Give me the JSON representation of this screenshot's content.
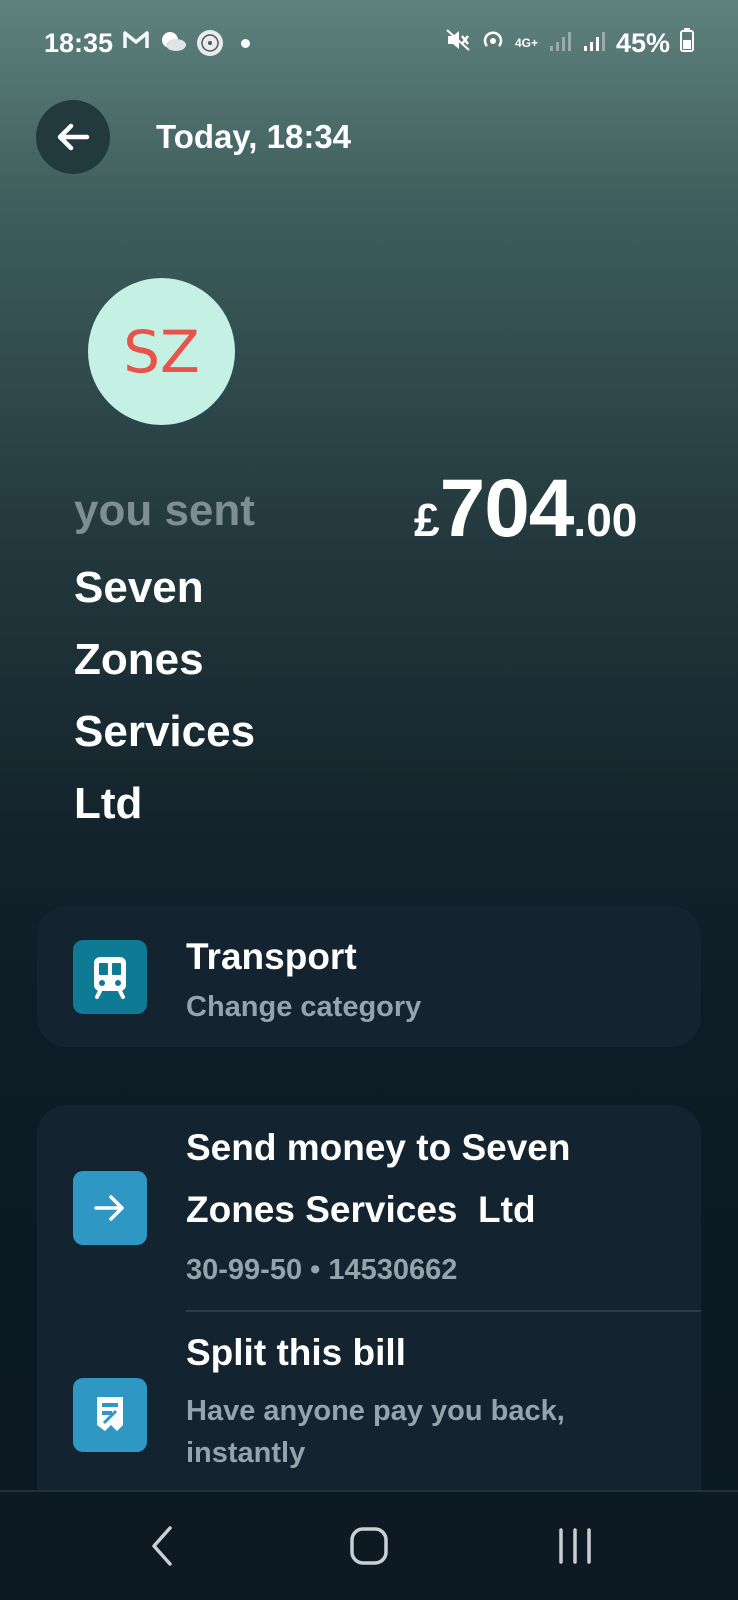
{
  "status_bar": {
    "time": "18:35",
    "battery": "45%",
    "network": "4G+",
    "icons": [
      "gmail-icon",
      "weather-icon",
      "word-game-icon",
      "notification-dot",
      "mute-icon",
      "hotspot-icon",
      "network-4g-icon",
      "signal-icon",
      "signal-icon",
      "battery-icon"
    ]
  },
  "header": {
    "title": "Today, 18:34"
  },
  "avatar": {
    "initials": "SZ",
    "background": "#c4f1e3",
    "text_color": "#e8534a"
  },
  "transaction": {
    "direction_label": "you sent",
    "recipient_lines": [
      "Seven",
      "Zones",
      "Services",
      "Ltd"
    ],
    "amount": {
      "currency": "£",
      "whole": "704",
      "decimal": ".00"
    }
  },
  "category": {
    "name": "Transport",
    "action": "Change category",
    "icon": "bus-icon",
    "icon_color": "#0f7a93"
  },
  "actions": [
    {
      "title_lines": [
        "Send money to Seven",
        "Zones Services  Ltd"
      ],
      "subtitle": "30-99-50 • 14530662",
      "icon": "arrow-right-icon",
      "icon_color": "#2e97c4"
    },
    {
      "title": "Split this bill",
      "subtitle_lines": [
        "Have anyone pay you back,",
        "instantly"
      ],
      "icon": "receipt-icon",
      "icon_color": "#2e97c4"
    }
  ],
  "nav": {
    "icons": [
      "back-nav-icon",
      "home-nav-icon",
      "recents-nav-icon"
    ]
  }
}
